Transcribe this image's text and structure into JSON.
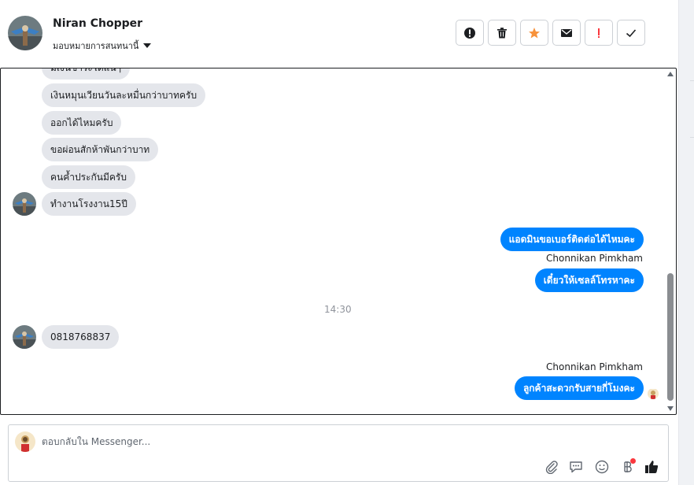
{
  "header": {
    "contact_name": "Niran Chopper",
    "assign_label": "มอบหมายการสนทนานี้",
    "actions": [
      {
        "icon": "alert-circle-icon"
      },
      {
        "icon": "trash-icon"
      },
      {
        "icon": "star-icon",
        "color": "#f7923b"
      },
      {
        "icon": "envelope-icon"
      },
      {
        "icon": "exclamation-icon",
        "color": "#fa383e"
      },
      {
        "icon": "check-icon"
      }
    ]
  },
  "conversation": {
    "incoming_partial": "มีเงินชำระได้แน่ๆ",
    "incoming": [
      "เงินหมุนเวียนวันละหมื่นกว่าบาทครับ",
      "ออกได้ไหมครับ",
      "ขอผ่อนสักห้าพันกว่าบาท",
      "คนค้ำประกันมีครับ",
      "ทำงานโรงงาน15ปี"
    ],
    "outgoing_1": "แอดมินขอเบอร์ติดต่อได้ไหมคะ",
    "sender_1": "Chonnikan Pimkham",
    "outgoing_2": "เดี๋ยวให้เซลล์โทรหาคะ",
    "timestamp": "14:30",
    "incoming_phone": "0818768837",
    "sender_2": "Chonnikan Pimkham",
    "outgoing_3": "ลูกค้าสะดวกรับสายกี่โมงคะ"
  },
  "composer": {
    "placeholder": "ตอบกลับใน Messenger...",
    "tools": [
      "paperclip-icon",
      "speech-bubble-icon",
      "smiley-icon",
      "baht-icon",
      "thumbs-up-icon"
    ]
  },
  "colors": {
    "outgoing_bubble": "#0084ff",
    "incoming_bubble": "#e4e6eb",
    "star": "#f7923b",
    "alert": "#fa383e"
  }
}
